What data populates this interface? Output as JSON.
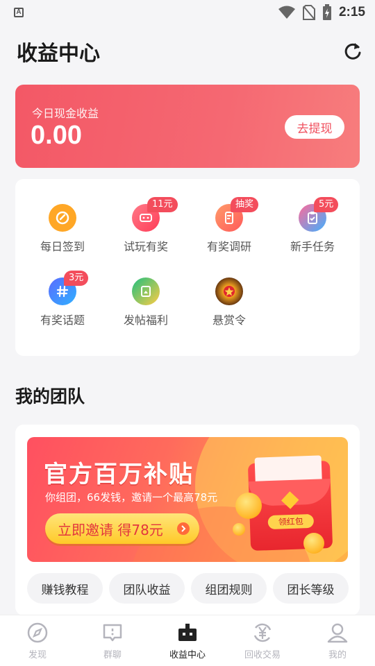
{
  "status_bar": {
    "time": "2:15",
    "app_indicator": "A"
  },
  "header": {
    "title": "收益中心",
    "refresh_icon": "refresh-icon"
  },
  "earnings": {
    "label": "今日现金收益",
    "amount": "0.00",
    "withdraw_label": "去提现"
  },
  "tasks": [
    {
      "label": "每日签到",
      "icon": "checkin-icon",
      "color": "#ffa726",
      "badge": ""
    },
    {
      "label": "试玩有奖",
      "icon": "game-icon",
      "color": "#ff5a6a",
      "badge": "11元"
    },
    {
      "label": "有奖调研",
      "icon": "survey-icon",
      "color": "#ff7a5a",
      "badge": "抽奖"
    },
    {
      "label": "新手任务",
      "icon": "clipboard-icon",
      "color": "#ff5a8a",
      "badge": "5元"
    },
    {
      "label": "有奖话题",
      "icon": "hashtag-icon",
      "color": "#3d7bff",
      "badge": "3元"
    },
    {
      "label": "发帖福利",
      "icon": "post-icon",
      "color": "#20c08a",
      "badge": ""
    },
    {
      "label": "悬赏令",
      "icon": "bounty-icon",
      "color": "#b8860b",
      "badge": ""
    }
  ],
  "team": {
    "title": "我的团队",
    "banner": {
      "headline": "官方百万补贴",
      "subtitle": "你组团，66发钱，邀请一个最高78元",
      "invite_label": "立即邀请 得78元",
      "envelope_tag": "领红包"
    },
    "tabs": [
      "赚钱教程",
      "团队收益",
      "组团规则",
      "团长等级"
    ]
  },
  "bottom_nav": [
    {
      "label": "发现",
      "icon": "compass-icon",
      "active": false
    },
    {
      "label": "群聊",
      "icon": "chat-icon",
      "active": false
    },
    {
      "label": "收益中心",
      "icon": "earnings-icon",
      "active": true
    },
    {
      "label": "回收交易",
      "icon": "recycle-yen-icon",
      "active": false
    },
    {
      "label": "我的",
      "icon": "profile-icon",
      "active": false
    }
  ]
}
